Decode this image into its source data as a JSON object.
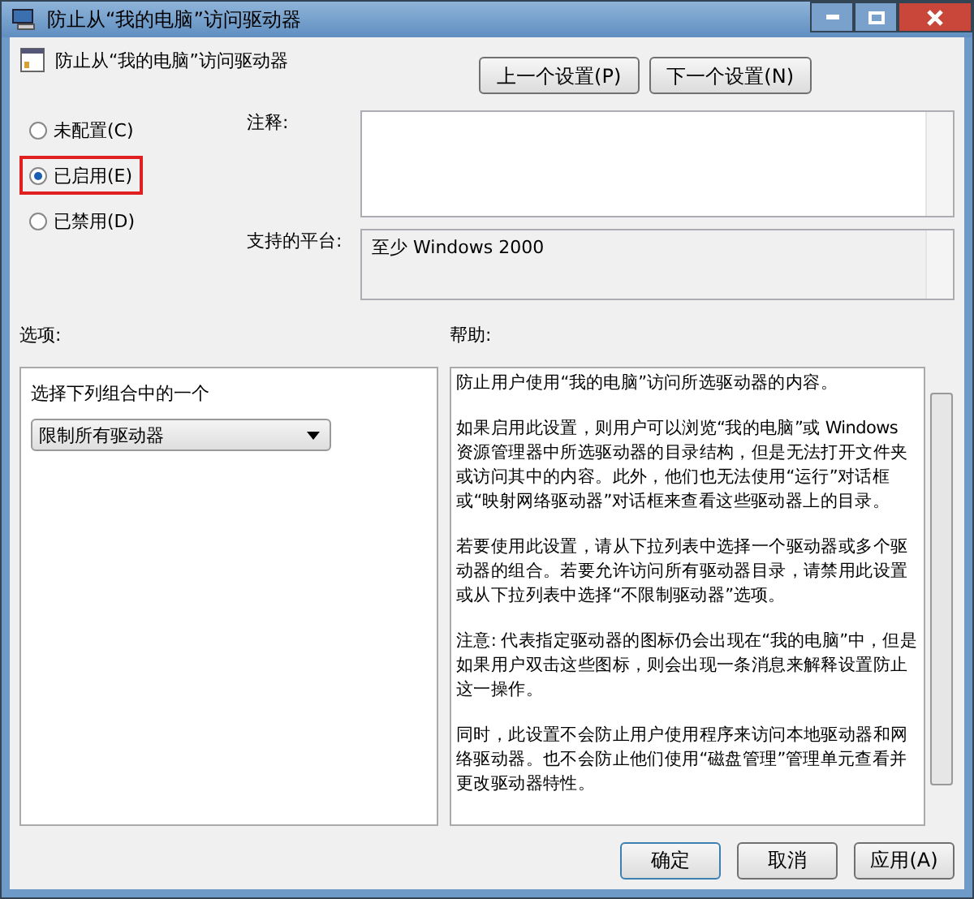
{
  "window": {
    "title": "防止从“我的电脑”访问驱动器"
  },
  "header": {
    "title": "防止从“我的电脑”访问驱动器",
    "buttons": [
      "上一个设置(P)",
      "下一个设置(N)"
    ]
  },
  "options": [
    {
      "label": "未配置(C)",
      "selected": false,
      "highlighted": false
    },
    {
      "label": "已启用(E)",
      "selected": true,
      "highlighted": true
    },
    {
      "label": "已禁用(D)",
      "selected": false,
      "highlighted": false
    }
  ],
  "comment": {
    "label": "注释:"
  },
  "platform": {
    "label": "支持的平台:",
    "value": "至少 Windows 2000"
  },
  "options_panel": {
    "label": "选项:",
    "prompt": "选择下列组合中的一个",
    "dropdown": "限制所有驱动器"
  },
  "help_panel": {
    "label": "帮助:",
    "paragraphs": [
      "防止用户使用“我的电脑”访问所选驱动器的内容。",
      "如果启用此设置，则用户可以浏览“我的电脑”或 Windows 资源管理器中所选驱动器的目录结构，但是无法打开文件夹或访问其中的内容。此外，他们也无法使用“运行”对话框或“映射网络驱动器”对话框来查看这些驱动器上的目录。",
      "若要使用此设置，请从下拉列表中选择一个驱动器或多个驱动器的组合。若要允许访问所有驱动器目录，请禁用此设置或从下拉列表中选择“不限制驱动器”选项。",
      "注意: 代表指定驱动器的图标仍会出现在“我的电脑”中，但是如果用户双击这些图标，则会出现一条消息来解释设置防止这一操作。",
      "同时，此设置不会防止用户使用程序来访问本地驱动器和网络驱动器。也不会防止他们使用“磁盘管理”管理单元查看并更改驱动器特性。"
    ]
  },
  "footer": {
    "buttons": [
      "确定",
      "取消",
      "应用(A)"
    ]
  }
}
